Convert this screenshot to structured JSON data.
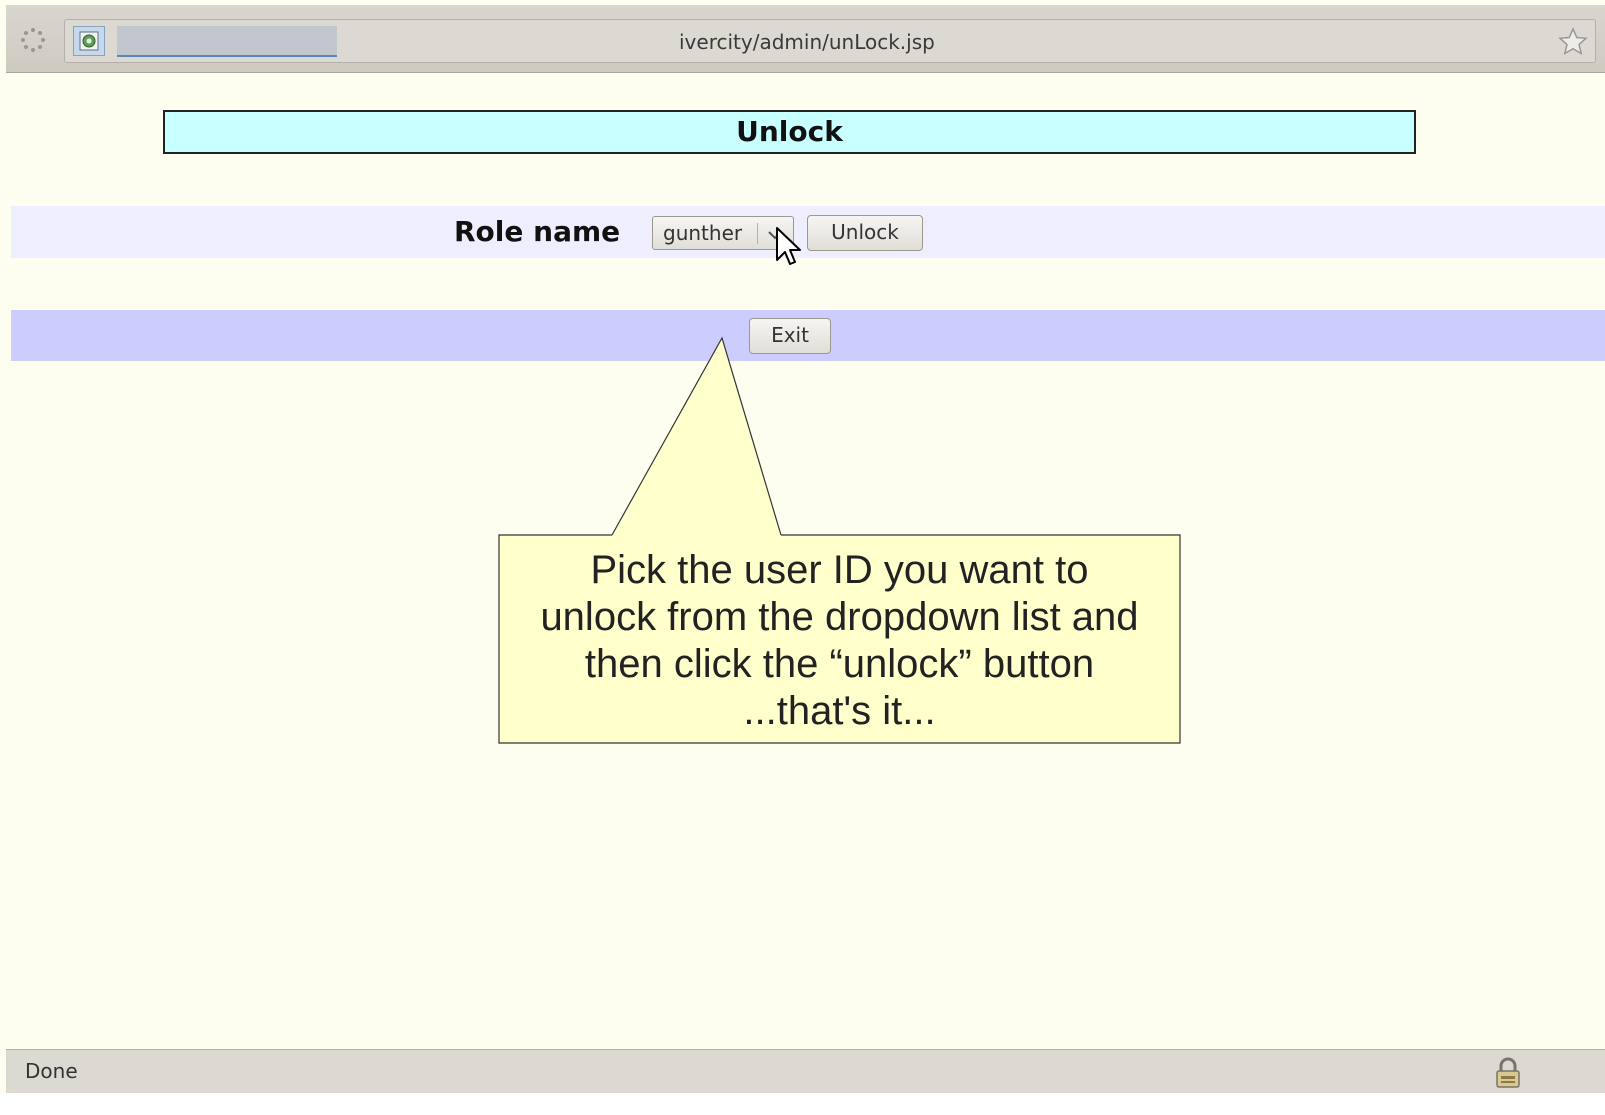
{
  "browser": {
    "url": "ivercity/admin/unLock.jsp",
    "status": "Done"
  },
  "page": {
    "title": "Unlock",
    "role_label": "Role name",
    "role_select_value": "gunther",
    "unlock_label": "Unlock",
    "exit_label": "Exit"
  },
  "callout": {
    "lines": [
      "Pick the user ID you want to",
      "unlock from the dropdown list and",
      "then click the “unlock” button",
      "...that's it..."
    ]
  },
  "colors": {
    "page_background": "#fefef0",
    "title_background": "#c8ffff",
    "role_row_background": "#eeeeff",
    "exit_row_background": "#ccccff",
    "callout_fill": "#ffffcc"
  },
  "icons": [
    "loading-spinner-icon",
    "site-icon",
    "bookmark-star-icon",
    "dropdown-arrow-icon",
    "mouse-cursor-icon",
    "lock-icon"
  ]
}
